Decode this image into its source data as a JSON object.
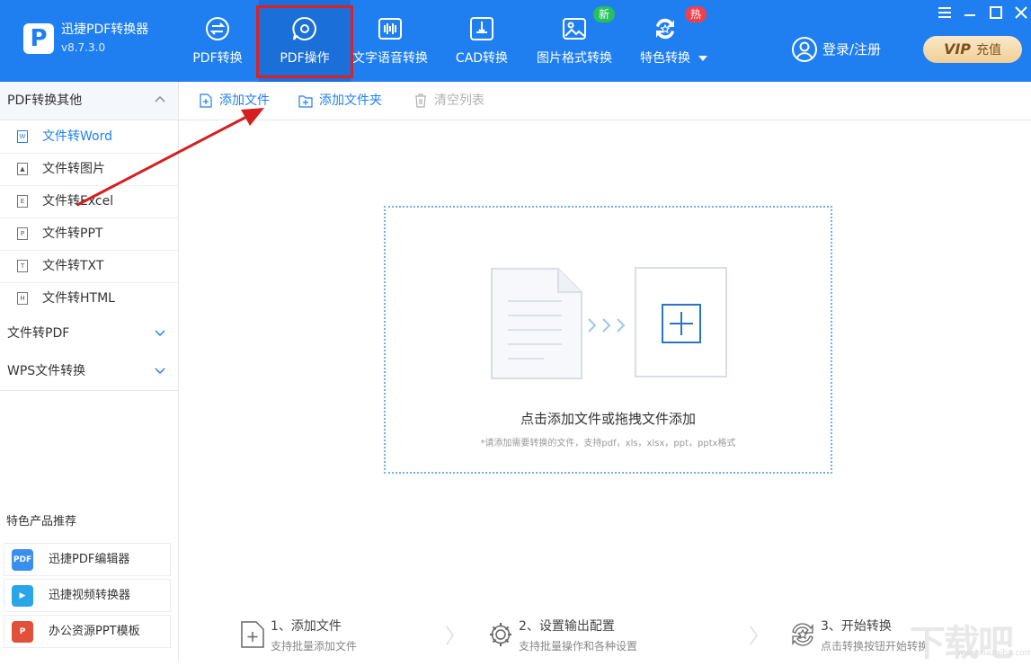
{
  "app": {
    "name": "迅捷PDF转换器",
    "version": "v8.7.3.0",
    "logo_letter": "P"
  },
  "nav": [
    {
      "label": "PDF转换",
      "icon": "exchange-icon"
    },
    {
      "label": "PDF操作",
      "icon": "gear-chat-icon"
    },
    {
      "label": "文字语音转换",
      "icon": "waveform-icon"
    },
    {
      "label": "CAD转换",
      "icon": "cad-icon"
    },
    {
      "label": "图片格式转换",
      "icon": "image-icon"
    },
    {
      "label": "特色转换",
      "icon": "star-refresh-icon"
    }
  ],
  "badges": {
    "new": "新",
    "hot": "热"
  },
  "window": {
    "minimize": "—",
    "maximize": "☐",
    "close": "✕"
  },
  "account": {
    "login": "登录/注册",
    "vip_brand": "VIP",
    "vip_action": "充值"
  },
  "sidebar": {
    "group1": "PDF转换其他",
    "items": [
      {
        "label": "文件转Word",
        "glyph": "W"
      },
      {
        "label": "文件转图片",
        "glyph": "▲"
      },
      {
        "label": "文件转Excel",
        "glyph": "E"
      },
      {
        "label": "文件转PPT",
        "glyph": "P"
      },
      {
        "label": "文件转TXT",
        "glyph": "T"
      },
      {
        "label": "文件转HTML",
        "glyph": "H"
      }
    ],
    "group2": "文件转PDF",
    "group3": "WPS文件转换",
    "promo_title": "特色产品推荐",
    "promos": [
      {
        "label": "迅捷PDF编辑器",
        "glyph": "PDF"
      },
      {
        "label": "迅捷视频转换器",
        "glyph": "▶"
      },
      {
        "label": "办公资源PPT模板",
        "glyph": "P"
      }
    ]
  },
  "toolbar": {
    "add_file": "添加文件",
    "add_folder": "添加文件夹",
    "clear_list": "清空列表"
  },
  "dropzone": {
    "main": "点击添加文件或拖拽文件添加",
    "sub": "*请添加需要转换的文件，支持pdf，xls，xlsx，ppt，pptx格式"
  },
  "steps": [
    {
      "title": "1、添加文件",
      "desc": "支持批量添加文件"
    },
    {
      "title": "2、设置输出配置",
      "desc": "支持批量操作和各种设置"
    },
    {
      "title": "3、开始转换",
      "desc": "点击转换按钮开始转换"
    }
  ],
  "watermark": {
    "text": "下载吧",
    "url": "www.xiazaiba.com"
  },
  "colors": {
    "primary": "#1f7ff0",
    "highlight": "#e02020",
    "new_badge": "#27c05c",
    "hot_badge": "#f2404a"
  }
}
